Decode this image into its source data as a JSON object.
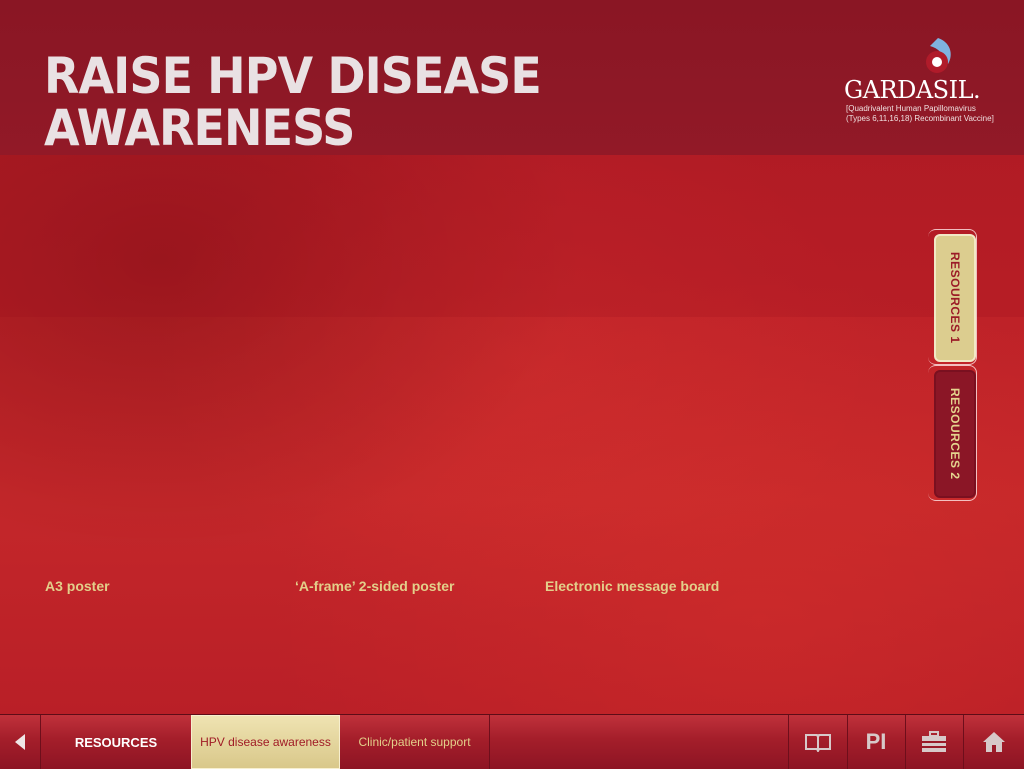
{
  "header": {
    "title_line1": "RAISE HPV DISEASE",
    "title_line2": "AWARENESS"
  },
  "brand": {
    "name": "GARDASIL.",
    "subtitle_line1": "[Quadrivalent Human Papillomavirus",
    "subtitle_line2": "(Types 6,11,16,18) Recombinant Vaccine]",
    "mark_colors": {
      "blue": "#7fb3e0",
      "red": "#b01b2a",
      "white": "#ffffff"
    }
  },
  "side_tabs": [
    {
      "label": "RESOURCES 1",
      "active": true
    },
    {
      "label": "RESOURCES 2",
      "active": false
    }
  ],
  "captions": [
    "A3 poster",
    "‘A-frame’ 2-sided poster",
    "Electronic message board"
  ],
  "bottom_nav": {
    "back_icon": "triangle-left-icon",
    "items": [
      {
        "label": "RESOURCES"
      },
      {
        "label": "HPV disease awareness",
        "active": true
      },
      {
        "label": "Clinic/patient support"
      }
    ],
    "pi_label": "PI",
    "icons": [
      "book-icon",
      "briefcase-icon",
      "home-icon"
    ]
  },
  "colors": {
    "background_red": "#bd2128",
    "header_band": "#8e1826",
    "caption_gold": "#e3cf8a",
    "active_tab": "#dccd8f"
  }
}
